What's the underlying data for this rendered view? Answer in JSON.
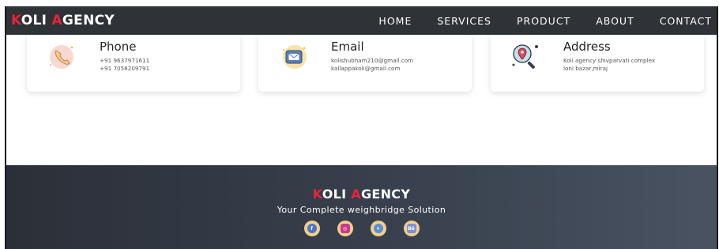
{
  "navbar": {
    "brand_prefix": "K",
    "brand_mid": "OLI ",
    "brand_accent": "A",
    "brand_suffix": "GENCY",
    "links": [
      "HOME",
      "SERVICES",
      "PRODUCT",
      "ABOUT",
      "CONTACT"
    ]
  },
  "cards": {
    "phone": {
      "title": "Phone",
      "lines": [
        "+91 9637971611",
        "+91 7058209791"
      ],
      "icon": "phone-icon"
    },
    "email": {
      "title": "Email",
      "lines": [
        "kolishubham210@gmail.com",
        "kallappakoli@gmail.com"
      ],
      "icon": "email-icon"
    },
    "address": {
      "title": "Address",
      "lines": [
        "Koli agency shivparvati complex",
        "loni bazar,miraj"
      ],
      "icon": "location-search-icon"
    }
  },
  "footer": {
    "brand_prefix": "K",
    "brand_mid": "OLI ",
    "brand_accent": "A",
    "brand_suffix": "GENCY",
    "tagline": "Your Complete weighbridge Solution",
    "socials": [
      {
        "name": "facebook-icon",
        "glyph": "f"
      },
      {
        "name": "instagram-icon",
        "glyph": "◎"
      },
      {
        "name": "twitter-icon",
        "glyph": "✦"
      },
      {
        "name": "behance-icon",
        "glyph": "Bē"
      }
    ]
  },
  "colors": {
    "accent": "#e8233b",
    "navbar_bg": "#2f3236",
    "footer_bg": "#3a4250",
    "social_bg": "#f2cf8d"
  }
}
